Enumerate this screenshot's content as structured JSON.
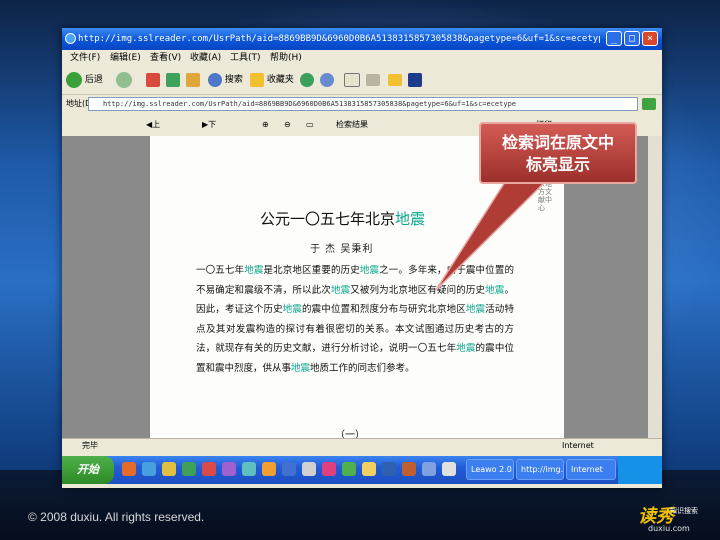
{
  "slide": {
    "footer": "© 2008 duxiu. All rights reserved.",
    "logo_text": "读秀",
    "logo_sub1": "知识搜索",
    "logo_sub2": "duxiu.com",
    "callout_line1": "检索词在原文中",
    "callout_line2": "标亮显示"
  },
  "window": {
    "title": "http://img.sslreader.com/UsrPath/aid=8869BB9D&6960D0B6A5138315857305838&pagetype=6&uf=1&sc=ecetype - Microsoft Inter..."
  },
  "menu": [
    "文件(F)",
    "编辑(E)",
    "查看(V)",
    "收藏(A)",
    "工具(T)",
    "帮助(H)"
  ],
  "toolbar": {
    "back": "后退",
    "search": "搜索",
    "favorites": "收藏夹"
  },
  "address": {
    "label": "地址(D)",
    "url": "http://img.sslreader.com/UsrPath/aid=8869BB9D&6960D0B6A5138315857305838&pagetype=6&uf=1&sc=ecetype"
  },
  "viewer_nav": {
    "prev": "上一页",
    "next": "下一页",
    "search_result": "检索结果",
    "print": "打印"
  },
  "article": {
    "title_main": "公元一〇五七年北京",
    "title_hl": "地震",
    "authors": "于  杰    吴秉利",
    "abstract": [
      {
        "t": "一〇五七年"
      },
      {
        "t": "地震",
        "h": true
      },
      {
        "t": "是北京地区重要的历史"
      },
      {
        "t": "地震",
        "h": true
      },
      {
        "t": "之一。多年来，由于震中位置的不易确定和震级不清，所以此次"
      },
      {
        "t": "地震",
        "h": true
      },
      {
        "t": "又被列为北京地区有疑问的历史"
      },
      {
        "t": "地震",
        "h": true
      },
      {
        "t": "。因此，考证这个历史"
      },
      {
        "t": "地震",
        "h": true
      },
      {
        "t": "的震中位置和烈度分布与研究北京地区"
      },
      {
        "t": "地震",
        "h": true
      },
      {
        "t": "活动特点及其对发震构造的探讨有着很密切的关系。本文试图通过历史考古的方法，就现存有关的历史文献，进行分析讨论，说明一〇五七年"
      },
      {
        "t": "地震",
        "h": true
      },
      {
        "t": "的震中位置和震中烈度，供从事"
      },
      {
        "t": "地震",
        "h": true
      },
      {
        "t": "地质工作的同志们参考。"
      }
    ],
    "section": "（一）",
    "side_text": "首都图书馆北京地方文献中心"
  },
  "status": {
    "left": "完毕",
    "right": "Internet"
  },
  "taskbar": {
    "start": "开始",
    "tasks": [
      "Leawo 2.0",
      "http://img...",
      "Internet"
    ]
  },
  "colors": {
    "highlight": "#0aa88e",
    "callout": "#b03c36"
  }
}
